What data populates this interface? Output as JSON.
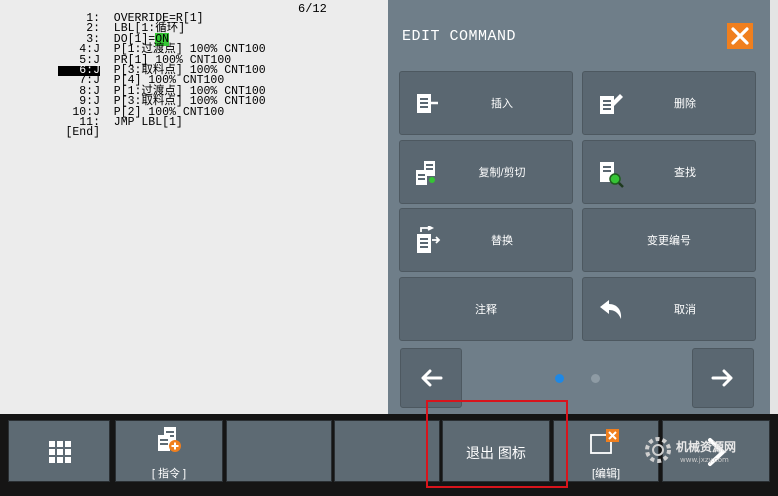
{
  "listing": {
    "counter": "6/12",
    "lines": [
      {
        "num": "1:",
        "text": "  OVERRIDE=R[1]"
      },
      {
        "num": "2:",
        "text": "  LBL[1:循环]"
      },
      {
        "num": "3:",
        "text": "  DO[1]=",
        "highlight": "ON"
      },
      {
        "num": "4:J",
        "text": "  P[1:过渡点] 100% CNT100"
      },
      {
        "num": "5:J",
        "text": "  PR[1] 100% CNT100"
      },
      {
        "num": "6:J",
        "text": "  P[3:取料点] 100% CNT100",
        "selected": true
      },
      {
        "num": "7:J",
        "text": "  P[4] 100% CNT100"
      },
      {
        "num": "8:J",
        "text": "  P[1:过渡点] 100% CNT100"
      },
      {
        "num": "9:J",
        "text": "  P[3:取料点] 100% CNT100"
      },
      {
        "num": "10:J",
        "text": "  P[2] 100% CNT100"
      },
      {
        "num": "11:",
        "text": "  JMP LBL[1]"
      },
      {
        "num": "[End]",
        "text": ""
      }
    ]
  },
  "panel": {
    "title": "EDIT COMMAND",
    "buttons": {
      "insert": "插入",
      "delete": "删除",
      "copy_cut": "复制/剪切",
      "find": "查找",
      "replace": "替换",
      "renumber": "变更编号",
      "comment": "注释",
      "undo": "取消"
    },
    "pager": {
      "pages": 2,
      "active": 1
    }
  },
  "softkeys": {
    "command": "[ 指令 ]",
    "exit_icon": "退出 图标",
    "edit": "[编辑]"
  },
  "watermark": {
    "text": "机械资源网",
    "sub": "www.jxzy.com"
  },
  "colors": {
    "accent": "#f07f1e",
    "panel": "#6f7e89",
    "button": "#5a6771",
    "highlight": "#35c435",
    "frame": "#d8141c"
  }
}
